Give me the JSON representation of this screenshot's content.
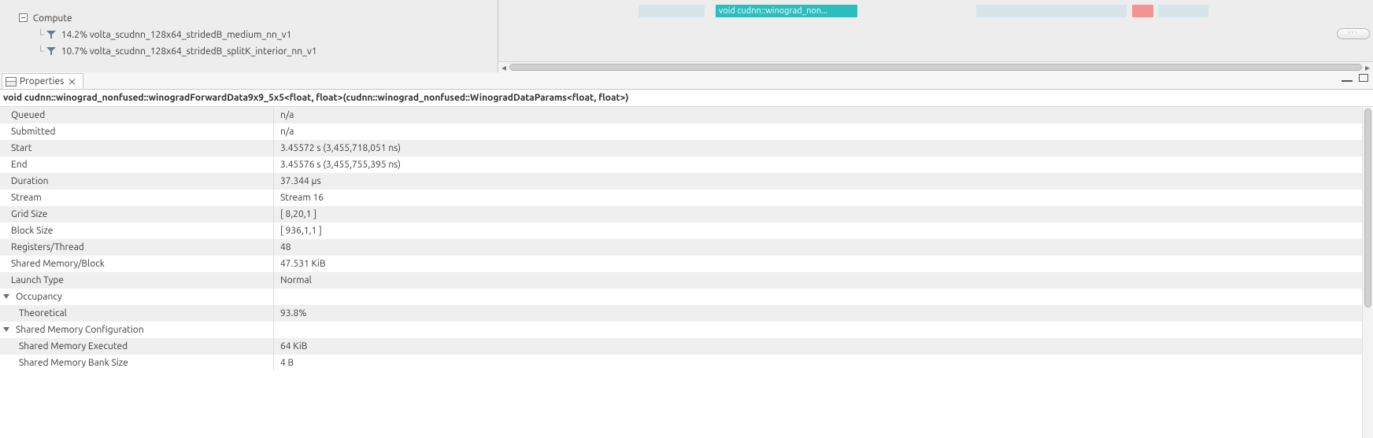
{
  "top_tree": {
    "parent_label": "Compute",
    "children": [
      "14.2% volta_scudnn_128x64_stridedB_medium_nn_v1",
      "10.7% volta_scudnn_128x64_stridedB_splitK_interior_nn_v1"
    ]
  },
  "timeline": {
    "active_bar_label": "void cudnn::winograd_non..."
  },
  "properties_tab": {
    "title": "Properties"
  },
  "kernel_signature": "void cudnn::winograd_nonfused::winogradForwardData9x9_5x5<float, float>(cudnn::winograd_nonfused::WinogradDataParams<float, float>)",
  "rows": [
    {
      "k": "Queued",
      "v": "n/a",
      "kind": "plain"
    },
    {
      "k": "Submitted",
      "v": "n/a",
      "kind": "plain"
    },
    {
      "k": "Start",
      "v": "3.45572 s (3,455,718,051 ns)",
      "kind": "plain"
    },
    {
      "k": "End",
      "v": "3.45576 s (3,455,755,395 ns)",
      "kind": "plain"
    },
    {
      "k": "Duration",
      "v": "37.344 µs",
      "kind": "plain"
    },
    {
      "k": "Stream",
      "v": "Stream 16",
      "kind": "plain"
    },
    {
      "k": "Grid Size",
      "v": "[ 8,20,1 ]",
      "kind": "plain"
    },
    {
      "k": "Block Size",
      "v": "[ 936,1,1 ]",
      "kind": "plain"
    },
    {
      "k": "Registers/Thread",
      "v": "48",
      "kind": "plain"
    },
    {
      "k": "Shared  Memory/Block",
      "v": "47.531 KiB",
      "kind": "plain"
    },
    {
      "k": "Launch Type",
      "v": "Normal",
      "kind": "plain"
    },
    {
      "k": "Occupancy",
      "v": "",
      "kind": "group"
    },
    {
      "k": "Theoretical",
      "v": "93.8%",
      "kind": "child"
    },
    {
      "k": "Shared Memory Configuration",
      "v": "",
      "kind": "group"
    },
    {
      "k": "Shared Memory Executed",
      "v": "64 KiB",
      "kind": "child"
    },
    {
      "k": "Shared Memory Bank Size",
      "v": "4 B",
      "kind": "child"
    }
  ]
}
